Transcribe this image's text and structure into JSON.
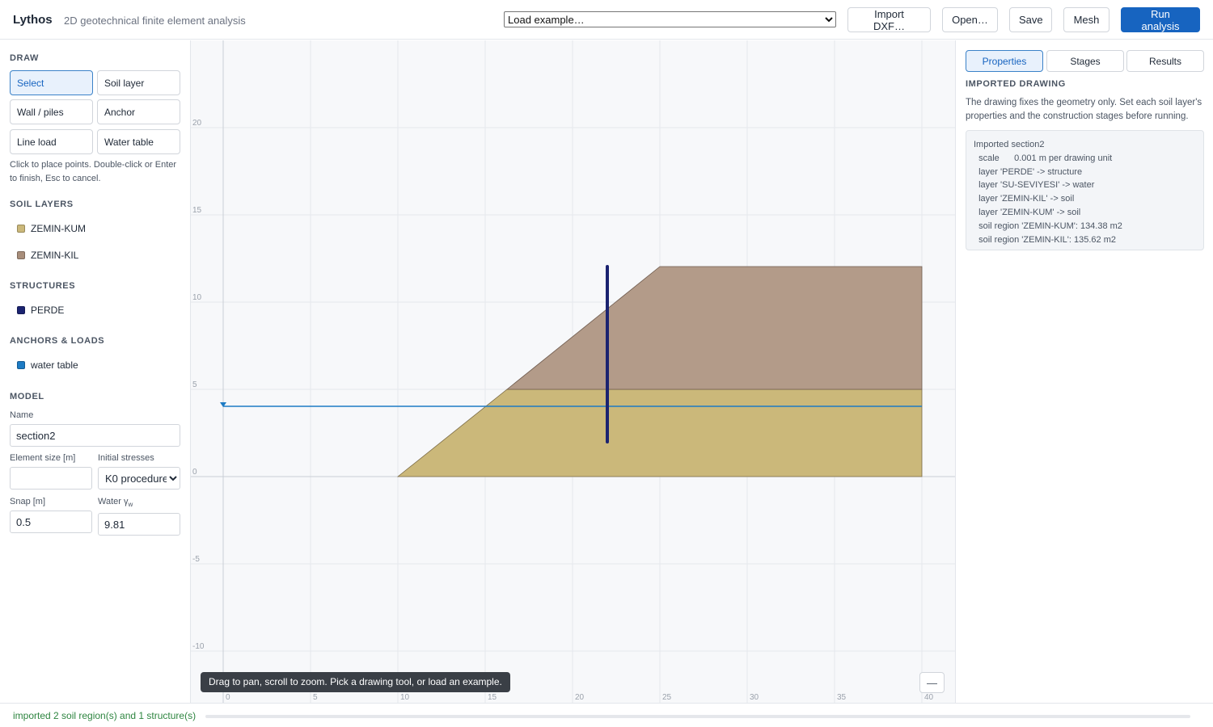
{
  "header": {
    "brand": "Lythos",
    "tagline": "2D geotechnical finite element analysis",
    "example_select": "Load example…",
    "buttons": {
      "import_dxf": "Import DXF…",
      "open": "Open…",
      "save": "Save",
      "mesh": "Mesh",
      "run": "Run analysis"
    }
  },
  "sidebar": {
    "draw": {
      "heading": "DRAW",
      "tools": {
        "select": "Select",
        "soil_layer": "Soil layer",
        "wall": "Wall / piles",
        "anchor": "Anchor",
        "line_load": "Line load",
        "water_table": "Water table"
      },
      "active_tool": "Select",
      "hint": "Click to place points. Double-click or Enter to finish, Esc to cancel."
    },
    "soil_layers": {
      "heading": "SOIL LAYERS",
      "items": [
        {
          "name": "ZEMIN-KUM",
          "color": "#cbb87a"
        },
        {
          "name": "ZEMIN-KIL",
          "color": "#a88e7b"
        }
      ]
    },
    "structures": {
      "heading": "STRUCTURES",
      "items": [
        {
          "name": "PERDE",
          "color": "#1b2370"
        }
      ]
    },
    "anchors_loads": {
      "heading": "ANCHORS & LOADS",
      "items": [
        {
          "name": "water table",
          "color": "#1d7bc4"
        }
      ]
    },
    "model": {
      "heading": "MODEL",
      "name_label": "Name",
      "name_value": "section2",
      "element_size_label": "Element size [m]",
      "element_size_value": "",
      "initial_stresses_label": "Initial stresses",
      "initial_stresses_value": "K0 procedure",
      "snap_label": "Snap [m]",
      "snap_value": "0.5",
      "water_label": "Water γ",
      "water_label_sub": "w",
      "water_value": "9.81"
    }
  },
  "canvas": {
    "x_ticks": [
      "0",
      "5",
      "10",
      "15",
      "20",
      "25",
      "30",
      "35",
      "40"
    ],
    "y_ticks": [
      "20",
      "15",
      "10",
      "5",
      "0",
      "-5",
      "-10"
    ],
    "tooltip": "Drag to pan, scroll to zoom. Pick a drawing tool, or load an example.",
    "minimize_label": "—",
    "colors": {
      "background": "#f7f8fa",
      "grid": "#e5e8ec",
      "sand": "#cbb87a",
      "clay": "#b39b89",
      "wall": "#1b2370",
      "water": "#1d7bc4"
    }
  },
  "right_panel": {
    "tabs": [
      "Properties",
      "Stages",
      "Results"
    ],
    "active_tab": "Properties",
    "section_title": "IMPORTED DRAWING",
    "description": "The drawing fixes the geometry only. Set each soil layer's properties and the construction stages before running.",
    "log": [
      "Imported section2",
      "  scale      0.001 m per drawing unit",
      "  layer 'PERDE' -> structure",
      "  layer 'SU-SEVIYESI' -> water",
      "  layer 'ZEMIN-KIL' -> soil",
      "  layer 'ZEMIN-KUM' -> soil",
      "  soil region 'ZEMIN-KUM': 134.38 m2",
      "  soil region 'ZEMIN-KIL': 135.62 m2"
    ]
  },
  "status": {
    "message": "imported 2 soil region(s) and 1 structure(s)",
    "progress": 0
  }
}
